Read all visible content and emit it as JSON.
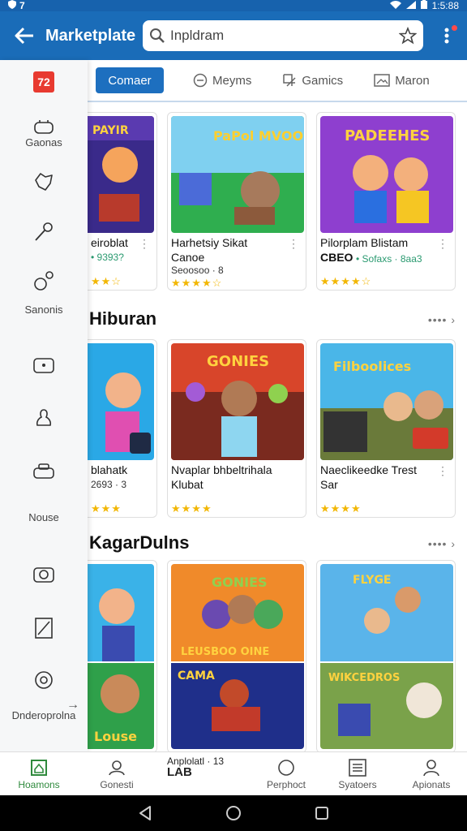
{
  "status": {
    "left": "7",
    "time": "1:5:88"
  },
  "appbar": {
    "title": "Marketplate",
    "search_value": "Inpldram"
  },
  "sidebar": {
    "items": [
      {
        "label": "",
        "icon": "brand-logo-icon"
      },
      {
        "label": "Gaonas",
        "icon": "gamepad-icon"
      },
      {
        "label": "",
        "icon": "puzzle-icon"
      },
      {
        "label": "",
        "icon": "key-icon"
      },
      {
        "label": "Sanonis",
        "icon": "people-icon"
      },
      {
        "label": "",
        "icon": "controller-icon"
      },
      {
        "label": "",
        "icon": "person-icon"
      },
      {
        "label": "Nouse",
        "icon": "controller-alt-icon"
      },
      {
        "label": "",
        "icon": "camera-icon"
      },
      {
        "label": "",
        "icon": "note-icon"
      },
      {
        "label": "Dnderoprolna",
        "icon": "settings-icon"
      }
    ]
  },
  "tabs": [
    {
      "label": "Comaer",
      "icon": ""
    },
    {
      "label": "Meyms",
      "icon": "circle-icon"
    },
    {
      "label": "Gamics",
      "icon": "crop-icon"
    },
    {
      "label": "Maron",
      "icon": "image-icon"
    }
  ],
  "row1": {
    "cards": [
      {
        "name": "eiroblat",
        "sub": "• 9393?",
        "stars": "★★☆",
        "art": "PAYIR"
      },
      {
        "name": "Harhetsiy Sikat",
        "sub2": "Canoe",
        "sub": "Seoosoo · 8",
        "stars": "★★★★☆",
        "art": "PaPol MVOOLE"
      },
      {
        "name": "Pilorplam Blistam",
        "sub2": "CBEO",
        "sub": "• Sofaxs · 8aa3",
        "stars": "★★★★☆",
        "art": "PADEEHES"
      }
    ]
  },
  "section2": {
    "title": "Hiburan",
    "more": "•••• ›"
  },
  "row2": {
    "cards": [
      {
        "name": "blahatk",
        "sub": "2693 · 3",
        "stars": "★★★",
        "art": ""
      },
      {
        "name": "Nvaplar bhbeltrihala",
        "sub2": "Klubat",
        "stars": "★★★★",
        "art": "GONIES"
      },
      {
        "name": "Naeclikeedke Trest",
        "sub2": "Sar",
        "stars": "★★★★",
        "art": "Filboolices"
      }
    ]
  },
  "section3": {
    "title": "KagarDulns",
    "more": "•••• ›"
  },
  "row3": {
    "cards": [
      {
        "art_top": "",
        "art_bottom": "Louse"
      },
      {
        "art_top": "GONIES",
        "art_bottom": "LEUSBOO OINE",
        "art_bottom2": "CAMA"
      },
      {
        "art_top": "FLYGE",
        "art_bottom": "WIKCEDROS"
      }
    ]
  },
  "bottomnav": {
    "items": [
      {
        "label": "Hoamons",
        "icon": "home-icon"
      },
      {
        "label": "Gonesti",
        "icon": "group-icon"
      },
      {
        "label": "Perphoct",
        "icon": "circle-icon"
      },
      {
        "label": "Syatoers",
        "icon": "list-icon"
      },
      {
        "label": "Apionats",
        "icon": "account-icon"
      }
    ],
    "middle_line1": "Anplolatl · 13",
    "middle_line2": "LAB"
  },
  "colors": {
    "primary": "#1a6cb8",
    "active_tab": "#1d6fbf",
    "active_nav": "#2f8a3d",
    "stars": "#f2b705"
  }
}
